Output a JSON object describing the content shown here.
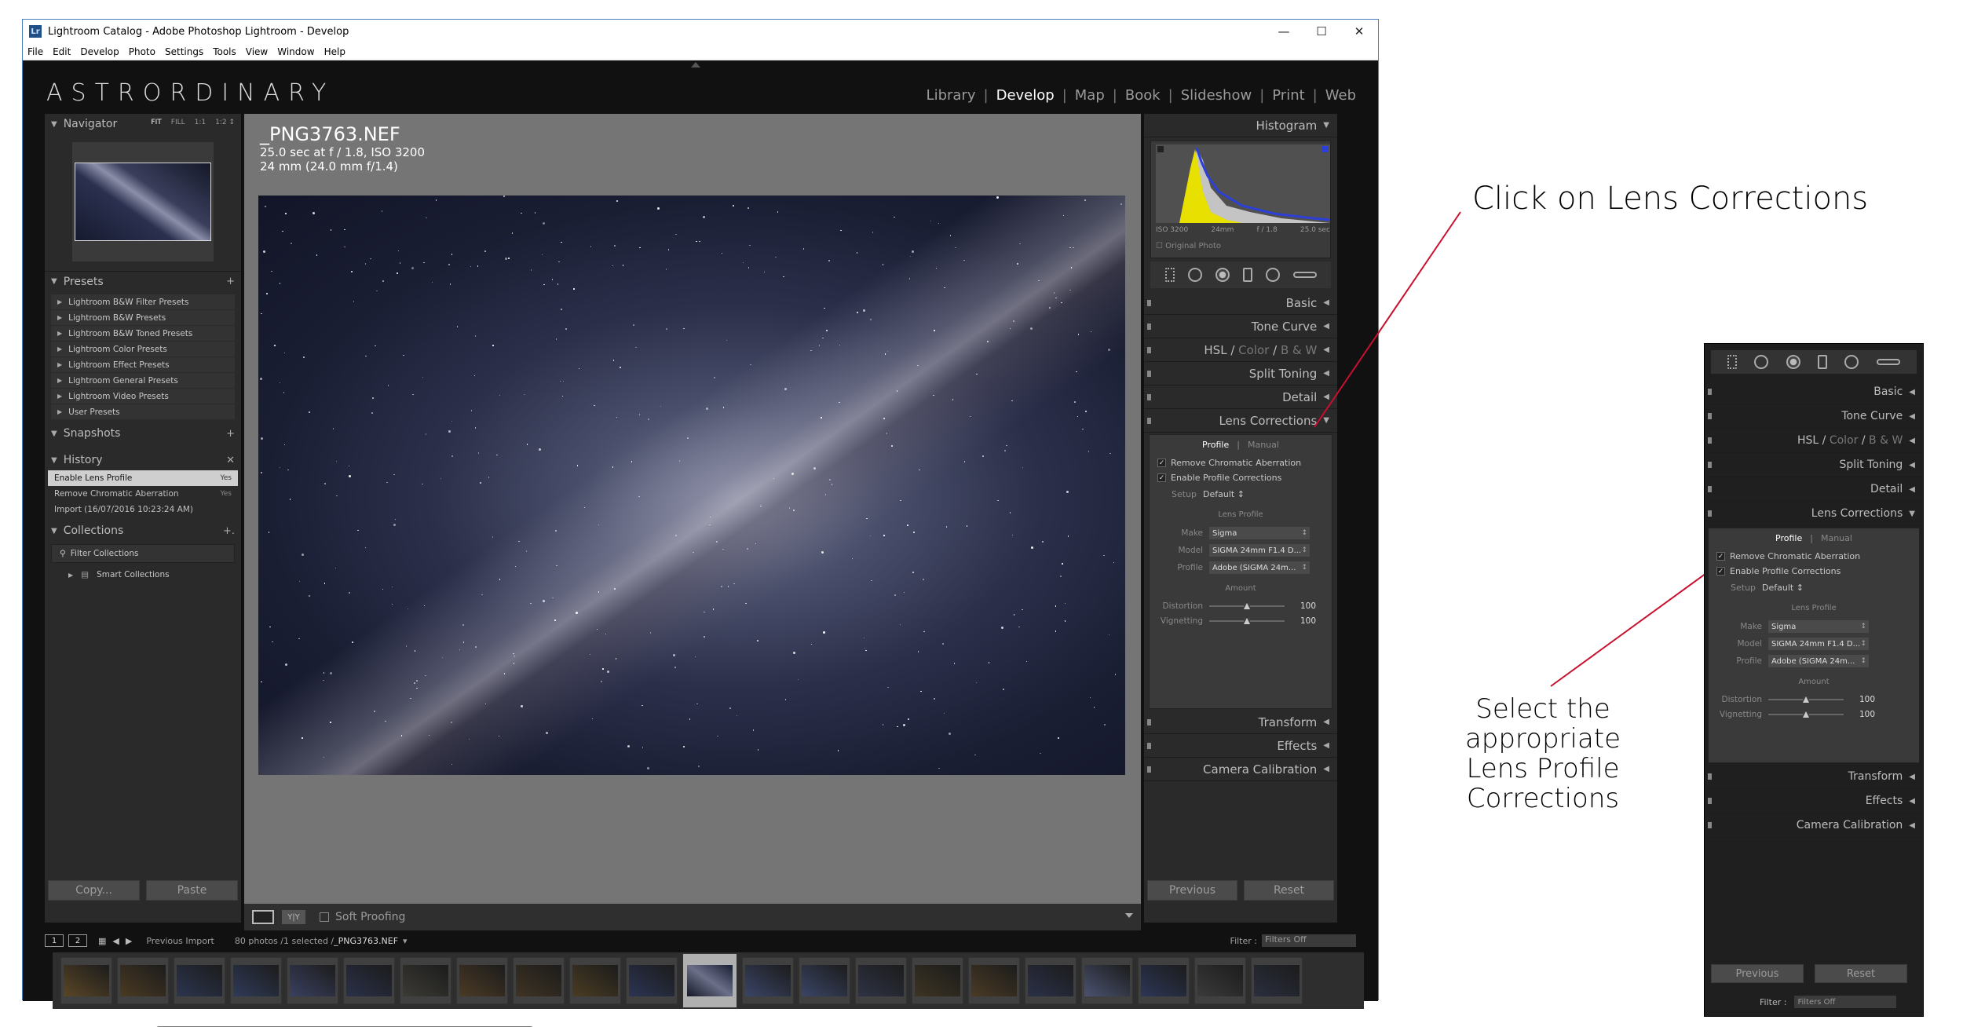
{
  "window": {
    "title": "Lightroom Catalog - Adobe Photoshop Lightroom - Develop",
    "app_icon": "Lr",
    "controls": {
      "minimize": "—",
      "maximize": "☐",
      "close": "✕"
    }
  },
  "menu": [
    "File",
    "Edit",
    "Develop",
    "Photo",
    "Settings",
    "Tools",
    "View",
    "Window",
    "Help"
  ],
  "identity_plate": "ASTRORDINARY",
  "modules": [
    "Library",
    "Develop",
    "Map",
    "Book",
    "Slideshow",
    "Print",
    "Web"
  ],
  "active_module": "Develop",
  "left_panel": {
    "navigator": {
      "title": "Navigator",
      "zoom": [
        "FIT",
        "FILL",
        "1:1",
        "1:2 ↕"
      ]
    },
    "presets": {
      "title": "Presets",
      "items": [
        "Lightroom B&W Filter Presets",
        "Lightroom B&W Presets",
        "Lightroom B&W Toned Presets",
        "Lightroom Color Presets",
        "Lightroom Effect Presets",
        "Lightroom General Presets",
        "Lightroom Video Presets",
        "User Presets"
      ]
    },
    "snapshots": {
      "title": "Snapshots"
    },
    "history": {
      "title": "History",
      "items": [
        {
          "label": "Enable Lens Profile",
          "value": "Yes"
        },
        {
          "label": "Remove Chromatic Aberration",
          "value": "Yes"
        },
        {
          "label": "Import (16/07/2016 10:23:24 AM)",
          "value": ""
        }
      ]
    },
    "collections": {
      "title": "Collections",
      "filter": "Filter Collections",
      "smart": "Smart Collections"
    },
    "copy_label": "Copy...",
    "paste_label": "Paste"
  },
  "photo_info": {
    "filename": "_PNG3763.NEF",
    "exposure": "25.0 sec at f / 1.8, ISO 3200",
    "lens": "24 mm (24.0 mm f/1.4)"
  },
  "toolbar": {
    "soft_proofing": "Soft Proofing",
    "yy_label": "Y|Y"
  },
  "right_panel": {
    "histogram": {
      "title": "Histogram",
      "iso": "ISO 3200",
      "focal": "24mm",
      "aperture": "f / 1.8",
      "shutter": "25.0 sec",
      "original": "Original Photo"
    },
    "sections": [
      "Basic",
      "Tone Curve",
      "HSL / Color / B & W",
      "Split Toning",
      "Detail",
      "Lens Corrections"
    ],
    "hsl_parts": [
      "HSL",
      "Color",
      "B & W"
    ],
    "lens": {
      "tabs": [
        "Profile",
        "Manual"
      ],
      "remove_ca": "Remove Chromatic Aberration",
      "enable_profile": "Enable Profile Corrections",
      "setup_label": "Setup",
      "setup_value": "Default ↕",
      "lens_profile_title": "Lens Profile",
      "make_label": "Make",
      "make_value": "Sigma",
      "model_label": "Model",
      "model_value": "SIGMA 24mm F1.4 D...",
      "profile_label": "Profile",
      "profile_value": "Adobe (SIGMA 24m...",
      "amount_title": "Amount",
      "distortion_label": "Distortion",
      "distortion_value": "100",
      "vignetting_label": "Vignetting",
      "vignetting_value": "100"
    },
    "lower_sections": [
      "Transform",
      "Effects",
      "Camera Calibration"
    ],
    "previous_label": "Previous",
    "reset_label": "Reset"
  },
  "filmstrip": {
    "page1": "1",
    "page2": "2",
    "source": "Previous Import",
    "count": "80 photos /1 selected /",
    "selected_file": "_PNG3763.NEF",
    "filter_label": "Filter :",
    "filter_value": "Filters Off"
  },
  "annotations": {
    "click_text": "Click on Lens Corrections",
    "select_line1": "Select the appropriate",
    "select_line2": "Lens Profile Corrections",
    "line_color": "#c8102e"
  },
  "inset": {
    "sections": [
      "Basic",
      "Tone Curve",
      "Split Toning",
      "Detail",
      "Lens Corrections"
    ],
    "model_value": "SIGMA 24mm F1.4 D...",
    "profile_value": "Adobe (SIGMA 24m...",
    "filter_label": "Filter :",
    "filter_value": "Filters Off"
  }
}
